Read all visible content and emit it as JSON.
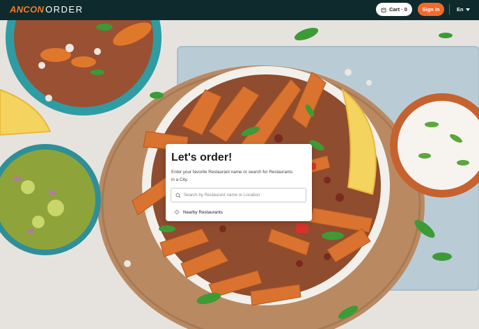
{
  "header": {
    "logo_brand": "ANCON",
    "logo_word": "ORDER",
    "cart_label": "Cart · 0",
    "signin_label": "Sign In",
    "language": "En"
  },
  "search_card": {
    "title": "Let's order!",
    "subtitle": "Enter your favorite Restaurant name or search for Restaurants in a City.",
    "search_placeholder": "Search by Restaurant name or Location",
    "search_value": "",
    "nearby_label": "Nearby Restaurants"
  },
  "icons": {
    "cart": "cart-icon",
    "search": "search-icon",
    "location": "location-icon",
    "language_caret": "chevron-down-icon"
  },
  "colors": {
    "header_bg": "#0f2a2c",
    "accent": "#f26b2a"
  }
}
